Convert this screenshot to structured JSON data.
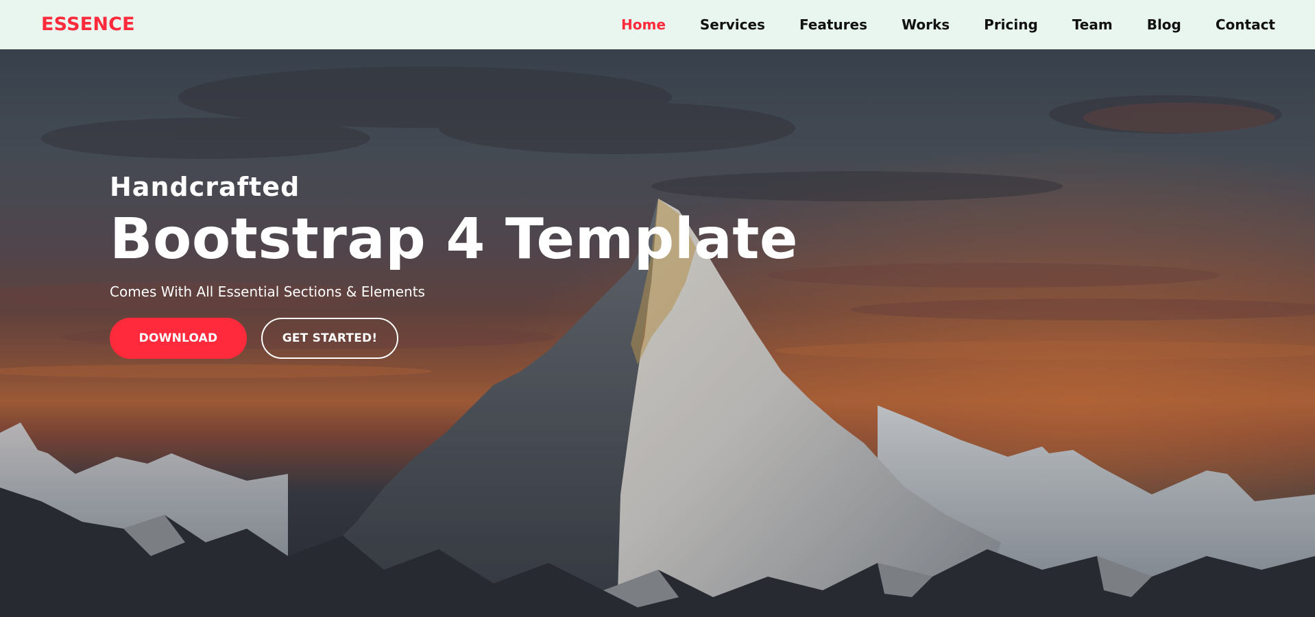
{
  "brand": {
    "name": "ESSENCE"
  },
  "nav": {
    "items": [
      {
        "label": "Home",
        "active": true
      },
      {
        "label": "Services",
        "active": false
      },
      {
        "label": "Features",
        "active": false
      },
      {
        "label": "Works",
        "active": false
      },
      {
        "label": "Pricing",
        "active": false
      },
      {
        "label": "Team",
        "active": false
      },
      {
        "label": "Blog",
        "active": false
      },
      {
        "label": "Contact",
        "active": false
      }
    ]
  },
  "hero": {
    "kicker": "Handcrafted",
    "title": "Bootstrap 4 Template",
    "subtitle": "Comes With All Essential Sections & Elements",
    "primary_button": "DOWNLOAD",
    "secondary_button": "GET STARTED!",
    "background_image": "mountain-sunset-photo"
  },
  "colors": {
    "accent": "#ff2a3b",
    "navbar_bg": "#e9f6ef",
    "nav_text": "#111111",
    "hero_text": "#ffffff"
  }
}
